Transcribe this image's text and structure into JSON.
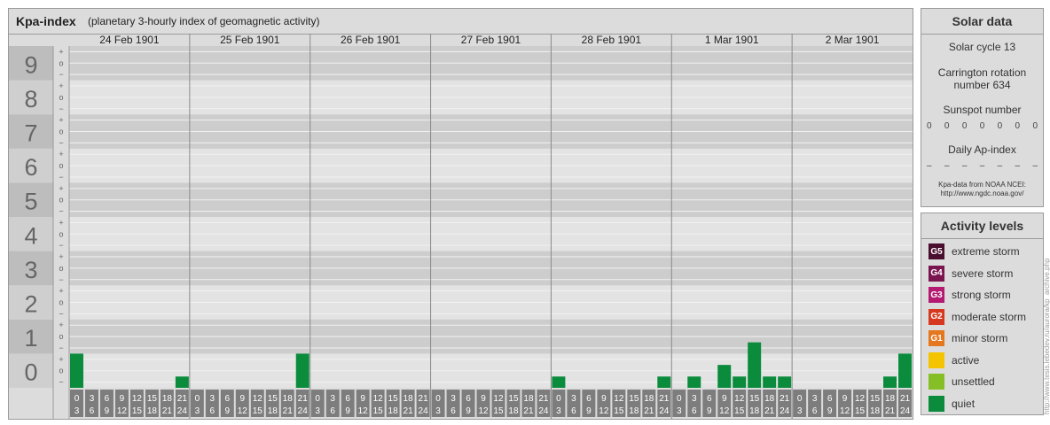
{
  "header": {
    "title": "Kpa-index",
    "subtitle": "(planetary 3-hourly index of geomagnetic activity)"
  },
  "chart_data": {
    "type": "bar",
    "title": "Kpa-index",
    "subtitle": "(planetary 3-hourly index of geomagnetic activity)",
    "ylim": [
      0,
      9
    ],
    "y_ticks": [
      "0",
      "1",
      "2",
      "3",
      "4",
      "5",
      "6",
      "7",
      "8",
      "9"
    ],
    "sub_ticks": [
      "+",
      "o",
      "−"
    ],
    "days": [
      "24 Feb 1901",
      "25 Feb 1901",
      "26 Feb 1901",
      "27 Feb 1901",
      "28 Feb 1901",
      "1 Mar 1901",
      "2 Mar 1901"
    ],
    "interval_labels": [
      [
        "0",
        "3"
      ],
      [
        "3",
        "6"
      ],
      [
        "6",
        "9"
      ],
      [
        "9",
        "12"
      ],
      [
        "12",
        "15"
      ],
      [
        "15",
        "18"
      ],
      [
        "18",
        "21"
      ],
      [
        "21",
        "24"
      ]
    ],
    "series": [
      {
        "values": [
          1.0,
          0.0,
          0.0,
          0.0,
          0.0,
          0.0,
          0.0,
          0.33,
          0.0,
          0.0,
          0.0,
          0.0,
          0.0,
          0.0,
          0.0,
          1.0,
          0.0,
          0.0,
          0.0,
          0.0,
          0.0,
          0.0,
          0.0,
          0.0,
          0.0,
          0.0,
          0.0,
          0.0,
          0.0,
          0.0,
          0.0,
          0.0,
          0.33,
          0.0,
          0.0,
          0.0,
          0.0,
          0.0,
          0.0,
          0.33,
          0.0,
          0.33,
          0.0,
          0.67,
          0.33,
          1.33,
          0.33,
          0.33,
          0.0,
          0.0,
          0.0,
          0.0,
          0.0,
          0.0,
          0.33,
          1.0
        ]
      }
    ],
    "bar_color": "#0a8c3c",
    "grid": true
  },
  "solar": {
    "title": "Solar data",
    "cycle": "Solar cycle 13",
    "carrington_line1": "Carrington rotation",
    "carrington_line2": "number 634",
    "sunspot_title": "Sunspot number",
    "sunspot_values": [
      "0",
      "0",
      "0",
      "0",
      "0",
      "0",
      "0"
    ],
    "ap_title": "Daily Ap-index",
    "ap_values": [
      "–",
      "–",
      "–",
      "–",
      "–",
      "–",
      "–"
    ],
    "source_line1": "Kpa-data from NOAA NCEI:",
    "source_line2": "http://www.ngdc.noaa.gov/"
  },
  "levels": {
    "title": "Activity levels",
    "items": [
      {
        "code": "G5",
        "label": "extreme storm",
        "color": "#4a0f2e"
      },
      {
        "code": "G4",
        "label": "severe storm",
        "color": "#7b1550"
      },
      {
        "code": "G3",
        "label": "strong storm",
        "color": "#b31a70"
      },
      {
        "code": "G2",
        "label": "moderate storm",
        "color": "#d6391f"
      },
      {
        "code": "G1",
        "label": "minor storm",
        "color": "#e5771e"
      },
      {
        "code": "",
        "label": "active",
        "color": "#f5c400"
      },
      {
        "code": "",
        "label": "unsettled",
        "color": "#86be25"
      },
      {
        "code": "",
        "label": "quiet",
        "color": "#0a8c3c"
      }
    ]
  },
  "watermark": "http://www.tesis.lebedev.ru/aurora/kp_archive.php"
}
